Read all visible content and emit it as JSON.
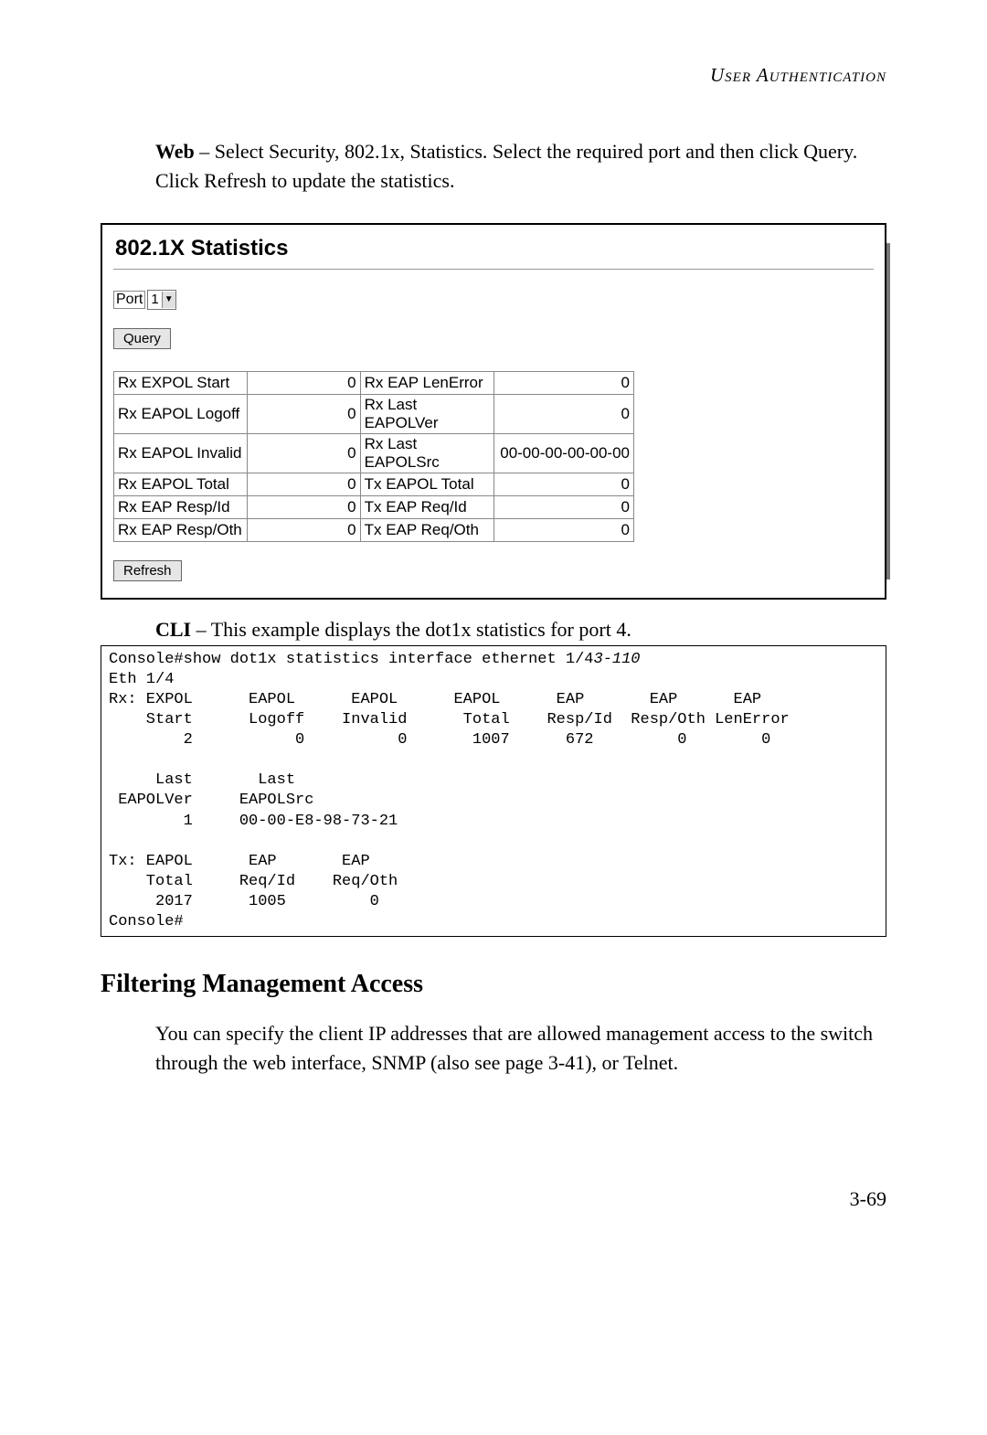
{
  "header": {
    "running": "User Authentication"
  },
  "intro": {
    "lead": "Web",
    "text": " – Select Security, 802.1x, Statistics. Select the required port and then click Query. Click Refresh to update the statistics."
  },
  "shot": {
    "title": "802.1X Statistics",
    "port_label": "Port",
    "port_value": "1",
    "query_btn": "Query",
    "refresh_btn": "Refresh",
    "rows": [
      {
        "l1": "Rx EXPOL Start",
        "v1": "0",
        "l2": "Rx EAP LenError",
        "v2": "0"
      },
      {
        "l1": "Rx EAPOL Logoff",
        "v1": "0",
        "l2": "Rx Last EAPOLVer",
        "v2": "0"
      },
      {
        "l1": "Rx EAPOL Invalid",
        "v1": "0",
        "l2": "Rx Last EAPOLSrc",
        "v2": "00-00-00-00-00-00"
      },
      {
        "l1": "Rx EAPOL Total",
        "v1": "0",
        "l2": "Tx EAPOL Total",
        "v2": "0"
      },
      {
        "l1": "Rx EAP Resp/Id",
        "v1": "0",
        "l2": "Tx EAP Req/Id",
        "v2": "0"
      },
      {
        "l1": "Rx EAP Resp/Oth",
        "v1": "0",
        "l2": "Tx EAP Req/Oth",
        "v2": "0"
      }
    ]
  },
  "cli": {
    "lead": "CLI",
    "caption": " – This example displays the dot1x statistics for port 4.",
    "cmd_prefix": "Console#show dot1x statistics interface ethernet 1/4",
    "cmd_ref": "3-110",
    "body": "\nEth 1/4\nRx: EXPOL      EAPOL      EAPOL      EAPOL      EAP       EAP      EAP\n    Start      Logoff    Invalid      Total    Resp/Id  Resp/Oth LenError\n        2           0          0       1007      672         0        0\n\n     Last       Last\n EAPOLVer     EAPOLSrc\n        1     00-00-E8-98-73-21\n\nTx: EAPOL      EAP       EAP\n    Total     Req/Id    Req/Oth\n     2017      1005         0\nConsole#"
  },
  "section": {
    "title": "Filtering Management Access",
    "body": "You can specify the client IP addresses that are allowed management access to the switch through the web interface, SNMP (also see page 3-41), or Telnet."
  },
  "page_number": "3-69",
  "chart_data": {
    "type": "table",
    "title": "802.1X Statistics (Port 1)",
    "rows": [
      [
        "Rx EXPOL Start",
        0,
        "Rx EAP LenError",
        0
      ],
      [
        "Rx EAPOL Logoff",
        0,
        "Rx Last EAPOLVer",
        0
      ],
      [
        "Rx EAPOL Invalid",
        0,
        "Rx Last EAPOLSrc",
        "00-00-00-00-00-00"
      ],
      [
        "Rx EAPOL Total",
        0,
        "Tx EAPOL Total",
        0
      ],
      [
        "Rx EAP Resp/Id",
        0,
        "Tx EAP Req/Id",
        0
      ],
      [
        "Rx EAP Resp/Oth",
        0,
        "Tx EAP Req/Oth",
        0
      ]
    ],
    "cli_sample": {
      "interface": "ethernet 1/4",
      "rx": {
        "EXPOL Start": 2,
        "EAPOL Logoff": 0,
        "EAPOL Invalid": 0,
        "EAPOL Total": 1007,
        "EAP Resp/Id": 672,
        "EAP Resp/Oth": 0,
        "EAP LenError": 0,
        "Last EAPOLVer": 1,
        "Last EAPOLSrc": "00-00-E8-98-73-21"
      },
      "tx": {
        "EAPOL Total": 2017,
        "EAP Req/Id": 1005,
        "EAP Req/Oth": 0
      }
    }
  }
}
